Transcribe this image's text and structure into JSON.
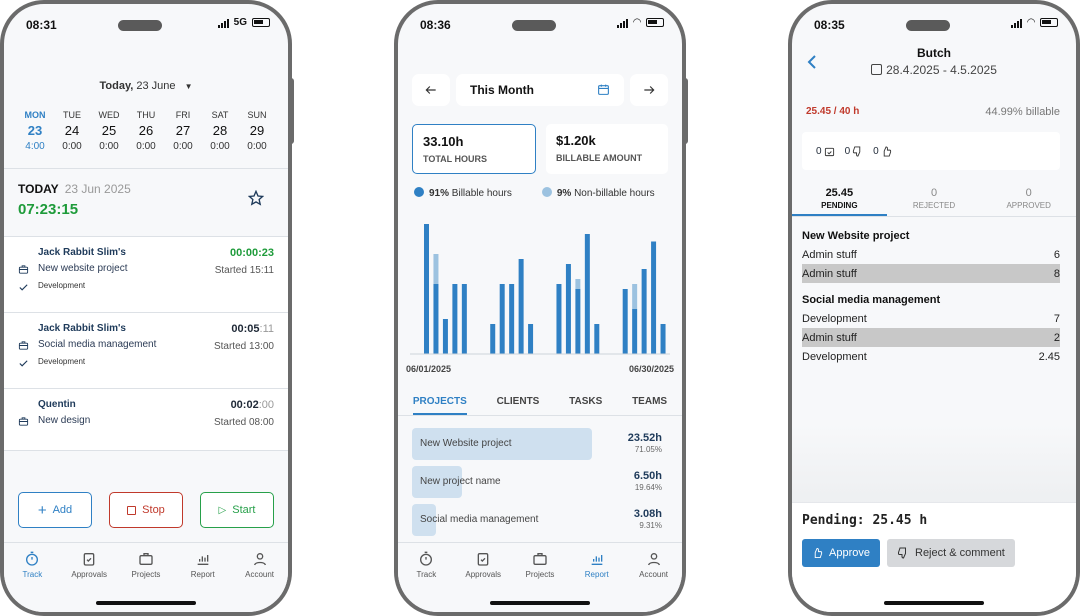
{
  "phone1": {
    "status": {
      "time": "08:31",
      "network": "5G"
    },
    "date_selector": {
      "label": "Today,",
      "value": "23 June"
    },
    "week": [
      {
        "name": "MON",
        "num": "23",
        "hours": "4:00",
        "active": true
      },
      {
        "name": "TUE",
        "num": "24",
        "hours": "0:00"
      },
      {
        "name": "WED",
        "num": "25",
        "hours": "0:00"
      },
      {
        "name": "THU",
        "num": "26",
        "hours": "0:00"
      },
      {
        "name": "FRI",
        "num": "27",
        "hours": "0:00"
      },
      {
        "name": "SAT",
        "num": "28",
        "hours": "0:00"
      },
      {
        "name": "SUN",
        "num": "29",
        "hours": "0:00"
      }
    ],
    "today": {
      "label": "TODAY",
      "date": "23 Jun 2025",
      "timer": "07:23:15"
    },
    "entries": [
      {
        "client": "Jack Rabbit Slim's",
        "duration": "00:00:23",
        "project": "New website project",
        "started": "Started 15:11",
        "task": "Development",
        "running": true
      },
      {
        "client": "Jack Rabbit Slim's",
        "duration_main": "00:05",
        "duration_sec": ":11",
        "project": "Social media management",
        "started": "Started 13:00",
        "task": "Development"
      },
      {
        "client": "Quentin",
        "duration_main": "00:02",
        "duration_sec": ":00",
        "project": "New design",
        "started": "Started 08:00"
      }
    ],
    "buttons": {
      "add": "Add",
      "stop": "Stop",
      "start": "Start"
    },
    "tabs": [
      "Track",
      "Approvals",
      "Projects",
      "Report",
      "Account"
    ],
    "active_tab": "Track"
  },
  "phone2": {
    "status": {
      "time": "08:36"
    },
    "period": "This Month",
    "kpis": [
      {
        "value": "33.10h",
        "label": "TOTAL HOURS"
      },
      {
        "value": "$1.20k",
        "label": "BILLABLE AMOUNT"
      }
    ],
    "legend": [
      {
        "pct": "91%",
        "label": "Billable hours",
        "color": "#2f80c4"
      },
      {
        "pct": "9%",
        "label": "Non-billable hours",
        "color": "#9cc2e0"
      }
    ],
    "chart_data": {
      "type": "bar",
      "x_start": "06/01/2025",
      "x_end": "06/30/2025",
      "series": [
        {
          "name": "Billable hours",
          "values": [
            5.2,
            2.8,
            1.4,
            2.8,
            2.8,
            0,
            0,
            1.2,
            2.8,
            2.8,
            3.8,
            1.2,
            0,
            0,
            2.8,
            3.6,
            2.6,
            4.8,
            1.2,
            0,
            0,
            2.6,
            1.8,
            3.4,
            4.5,
            1.2
          ]
        },
        {
          "name": "Non-billable hours",
          "values": [
            0,
            1.2,
            0,
            0,
            0,
            0,
            0,
            0,
            0,
            0,
            0,
            0,
            0,
            0,
            0,
            0,
            0.4,
            0,
            0,
            0,
            0,
            0,
            1.0,
            0,
            0,
            0
          ]
        }
      ]
    },
    "tabs": [
      "PROJECTS",
      "CLIENTS",
      "TASKS",
      "TEAMS"
    ],
    "active_tab_label": "PROJECTS",
    "projects": [
      {
        "name": "New Website project",
        "hours": "23.52h",
        "pct": "71.05%",
        "share": 0.7105
      },
      {
        "name": "New project name",
        "hours": "6.50h",
        "pct": "19.64%",
        "share": 0.1964
      },
      {
        "name": "Social media management",
        "hours": "3.08h",
        "pct": "9.31%",
        "share": 0.0931
      }
    ],
    "nav_tabs": [
      "Track",
      "Approvals",
      "Projects",
      "Report",
      "Account"
    ],
    "active_nav": "Report"
  },
  "phone3": {
    "status": {
      "time": "08:35"
    },
    "name": "Butch",
    "range": "28.4.2025 - 4.5.2025",
    "hours": "25.45 / 40 h",
    "billable": "44.99% billable",
    "counts": [
      "0",
      "0",
      "0"
    ],
    "status_tabs": [
      {
        "num": "25.45",
        "label": "PENDING"
      },
      {
        "num": "0",
        "label": "REJECTED"
      },
      {
        "num": "0",
        "label": "APPROVED"
      }
    ],
    "groups": [
      {
        "title": "New Website project",
        "rows": [
          {
            "task": "Admin stuff",
            "value": "6"
          },
          {
            "task": "Admin stuff",
            "value": "8"
          }
        ]
      },
      {
        "title": "Social media management",
        "rows": [
          {
            "task": "Development",
            "value": "7"
          },
          {
            "task": "Admin stuff",
            "value": "2"
          },
          {
            "task": "Development",
            "value": "2.45"
          }
        ]
      }
    ],
    "pending": "Pending: 25.45 h",
    "approve": "Approve",
    "reject": "Reject & comment"
  }
}
